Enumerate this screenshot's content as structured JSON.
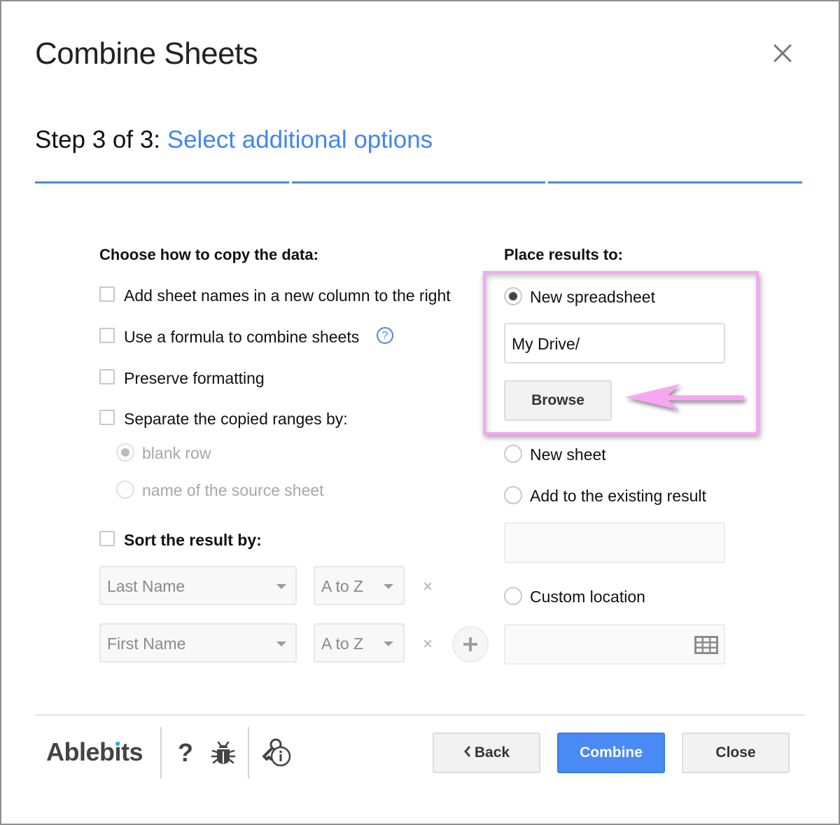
{
  "dialog": {
    "title": "Combine Sheets",
    "close_icon": "close-icon",
    "step_prefix": "Step 3 of 3: ",
    "step_title": "Select additional options",
    "step_progress": {
      "current": 3,
      "total": 3
    },
    "accent_color": "#4285f4"
  },
  "copy_options": {
    "heading": "Choose how to copy the data:",
    "items": [
      {
        "label": "Add sheet names in a new column to the right",
        "checked": false
      },
      {
        "label": "Use a formula to combine sheets",
        "checked": false,
        "help_icon": "help-circle-icon",
        "help_glyph": "?"
      },
      {
        "label": "Preserve formatting",
        "checked": false
      },
      {
        "label": "Separate the copied ranges by:",
        "checked": false
      }
    ],
    "separator_options": [
      {
        "label": "blank row",
        "selected": true,
        "disabled": true
      },
      {
        "label": "name of the source sheet",
        "selected": false,
        "disabled": true
      }
    ]
  },
  "sort": {
    "label": "Sort the result by:",
    "checked": false,
    "rows": [
      {
        "column": "Last Name",
        "order": "A to Z",
        "remove_glyph": "×"
      },
      {
        "column": "First Name",
        "order": "A to Z",
        "remove_glyph": "×"
      }
    ],
    "add_icon": "plus-icon"
  },
  "place_results": {
    "heading": "Place results to:",
    "options": [
      {
        "label": "New spreadsheet",
        "selected": true
      },
      {
        "label": "New sheet",
        "selected": false
      },
      {
        "label": "Add to the existing result",
        "selected": false
      },
      {
        "label": "Custom location",
        "selected": false
      }
    ],
    "path_value": "My Drive/",
    "browse_label": "Browse",
    "existing_result_value": "",
    "custom_location_value": "",
    "range_icon": "grid-icon",
    "highlight_color": "#f7a6f2"
  },
  "footer": {
    "logo": "Ablebits",
    "help_glyph": "?",
    "bug_icon": "bug-icon",
    "license_icon": "key-info-icon",
    "back_label": "Back",
    "combine_label": "Combine",
    "close_label": "Close",
    "primary_color": "#4a8af4"
  }
}
